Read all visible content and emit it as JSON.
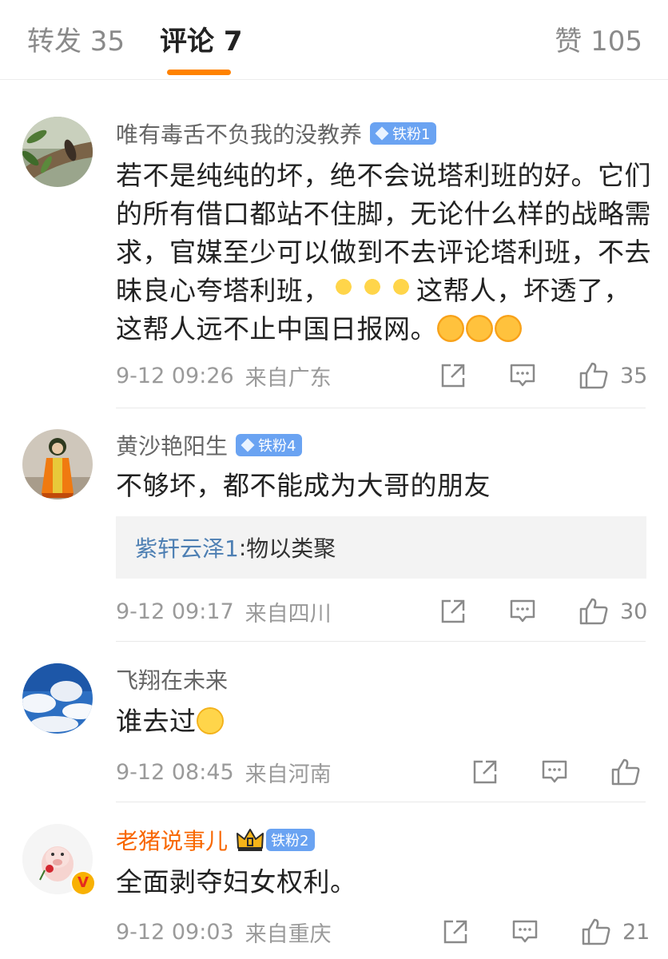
{
  "tabs": {
    "repost": "转发 35",
    "comments": "评论 7",
    "likes": "赞 105",
    "accent_color": "#ff8200"
  },
  "comments": [
    {
      "username": "唯有毒舌不负我的没教养",
      "badge": "铁粉1",
      "content_parts": [
        "若不是纯纯的坏，绝不会说塔利班的好。它们的所有借口都站不住脚，无论什么样的战略需求，官媒至少可以做到不去评论塔利班，不去昧良心夸塔利班，",
        "这帮人，坏透了，这帮人远不止中国日报网。"
      ],
      "time": "9-12 09:26",
      "source": "来自广东",
      "like_count": "35"
    },
    {
      "username": "黄沙艳阳生",
      "badge": "铁粉4",
      "content": "不够坏，都不能成为大哥的朋友",
      "quote_author": "紫轩云泽1",
      "quote_text": "物以类聚",
      "time": "9-12 09:17",
      "source": "来自四川",
      "like_count": "30"
    },
    {
      "username": "飞翔在未来",
      "content": "谁去过",
      "time": "9-12 08:45",
      "source": "来自河南",
      "like_count": ""
    },
    {
      "username": "老猪说事儿",
      "badge": "铁粉2",
      "content": "全面剥夺妇女权利。",
      "time": "9-12 09:03",
      "source": "来自重庆",
      "like_count": "21"
    }
  ],
  "colors": {
    "vip_name": "#f86700",
    "quote_author": "#4d7fb3",
    "fan_badge": "#6aa3f2"
  },
  "icons": [
    "share-icon",
    "comment-icon",
    "thumbs-up-icon",
    "crown-icon",
    "diamond-icon",
    "verified-icon"
  ]
}
